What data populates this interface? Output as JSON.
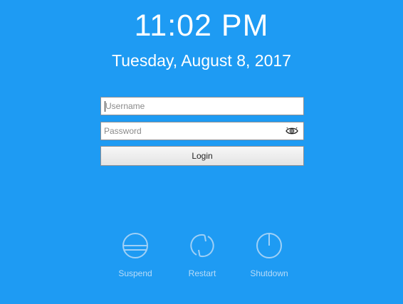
{
  "clock": {
    "time": "11:02 PM",
    "date": "Tuesday, August 8, 2017"
  },
  "login_form": {
    "username_placeholder": "Username",
    "username_value": "",
    "password_placeholder": "Password",
    "password_value": "",
    "reveal_icon": "eye-icon",
    "login_label": "Login"
  },
  "power_actions": [
    {
      "label": "Suspend",
      "icon": "suspend-icon"
    },
    {
      "label": "Restart",
      "icon": "restart-icon"
    },
    {
      "label": "Shutdown",
      "icon": "power-icon"
    }
  ],
  "colors": {
    "background": "#1e9bf3",
    "text": "#ffffff",
    "power_icon_stroke": "#9fd0f6",
    "power_label": "#b8dcf8"
  }
}
